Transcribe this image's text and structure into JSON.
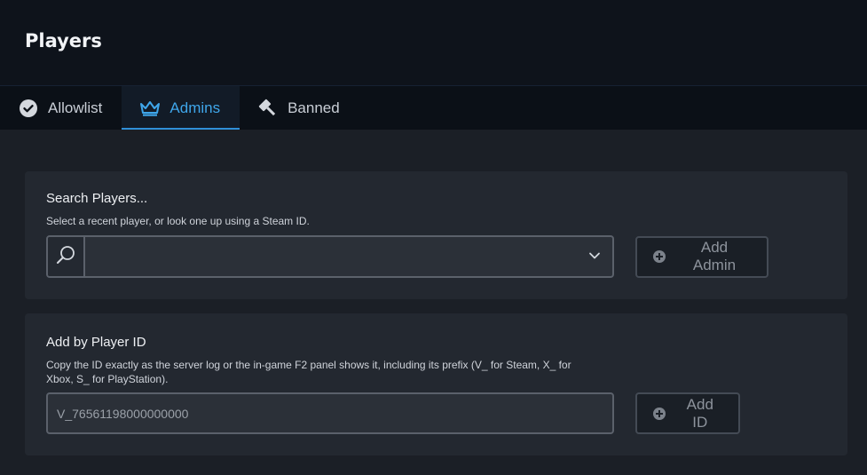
{
  "header": {
    "title": "Players"
  },
  "tabs": [
    {
      "label": "Allowlist",
      "icon": "check-circle-icon",
      "active": false
    },
    {
      "label": "Admins",
      "icon": "crown-icon",
      "active": true
    },
    {
      "label": "Banned",
      "icon": "ban-hammer-icon",
      "active": false
    }
  ],
  "search_card": {
    "title": "Search Players...",
    "description": "Select a recent player, or look one up using a Steam ID.",
    "input_value": "",
    "button_label": "Add Admin"
  },
  "id_card": {
    "title": "Add by Player ID",
    "description_line1": "Copy the ID exactly as the server log or the in-game F2 panel shows it, including its prefix (V_ for Steam, X_ for",
    "description_line2": "Xbox, S_ for PlayStation).",
    "placeholder": "V_76561198000000000",
    "button_label": "Add ID"
  },
  "colors": {
    "accent": "#3fa6ea",
    "background": "#1b1f26",
    "card": "#232830"
  }
}
